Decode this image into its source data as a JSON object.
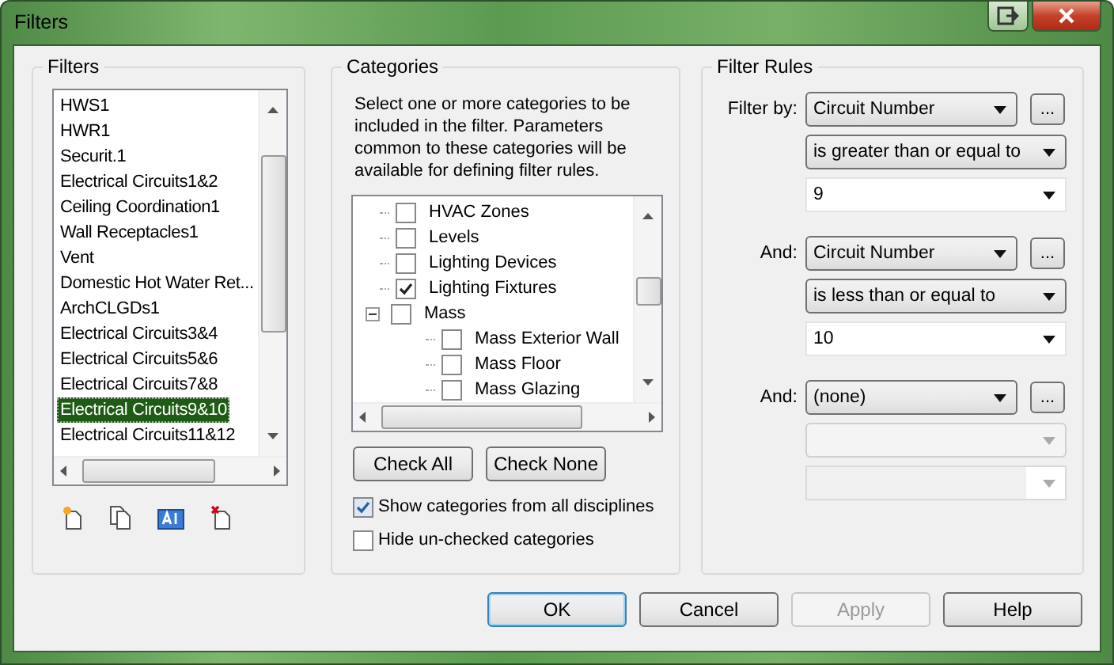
{
  "window": {
    "title": "Filters"
  },
  "filters": {
    "title": "Filters",
    "items": [
      {
        "label": "HWS1",
        "selected": false
      },
      {
        "label": "HWR1",
        "selected": false
      },
      {
        "label": "Securit.1",
        "selected": false
      },
      {
        "label": "Electrical Circuits1&2",
        "selected": false
      },
      {
        "label": "Ceiling Coordination1",
        "selected": false
      },
      {
        "label": "Wall Receptacles1",
        "selected": false
      },
      {
        "label": "Vent",
        "selected": false
      },
      {
        "label": "Domestic Hot Water Ret...",
        "selected": false
      },
      {
        "label": "ArchCLGDs1",
        "selected": false
      },
      {
        "label": "Electrical Circuits3&4",
        "selected": false
      },
      {
        "label": "Electrical Circuits5&6",
        "selected": false
      },
      {
        "label": "Electrical Circuits7&8",
        "selected": false
      },
      {
        "label": "Electrical Circuits9&10",
        "selected": true
      },
      {
        "label": "Electrical Circuits11&12",
        "selected": false
      }
    ]
  },
  "categories": {
    "title": "Categories",
    "description": "Select one or more categories to be included in the filter.  Parameters common to these categories will be available for defining filter rules.",
    "tree": [
      {
        "label": "HVAC Zones",
        "checked": false
      },
      {
        "label": "Levels",
        "checked": false
      },
      {
        "label": "Lighting Devices",
        "checked": false
      },
      {
        "label": "Lighting Fixtures",
        "checked": true
      },
      {
        "label": "Mass",
        "checked": false,
        "expanded": true,
        "children": [
          {
            "label": "Mass Exterior Wall",
            "checked": false
          },
          {
            "label": "Mass Floor",
            "checked": false
          },
          {
            "label": "Mass Glazing",
            "checked": false
          }
        ]
      }
    ],
    "buttons": [
      "Check All",
      "Check None"
    ],
    "options": [
      {
        "label": "Show categories from all disciplines",
        "checked": true
      },
      {
        "label": "Hide un-checked categories",
        "checked": false
      }
    ]
  },
  "filter_rules": {
    "title": "Filter Rules",
    "rules": [
      {
        "label": "Filter by:",
        "parameter": "Circuit Number",
        "operator": "is greater than or equal to",
        "value": "9",
        "enabled": true
      },
      {
        "label": "And:",
        "parameter": "Circuit Number",
        "operator": "is less than or equal to",
        "value": "10",
        "enabled": true
      },
      {
        "label": "And:",
        "parameter": "(none)",
        "enabled": false
      }
    ],
    "more_button": "..."
  },
  "buttons": [
    {
      "label": "OK",
      "default": true,
      "disabled": false
    },
    {
      "label": "Cancel",
      "default": false,
      "disabled": false
    },
    {
      "label": "Apply",
      "default": false,
      "disabled": true
    },
    {
      "label": "Help",
      "default": false,
      "disabled": false
    }
  ]
}
